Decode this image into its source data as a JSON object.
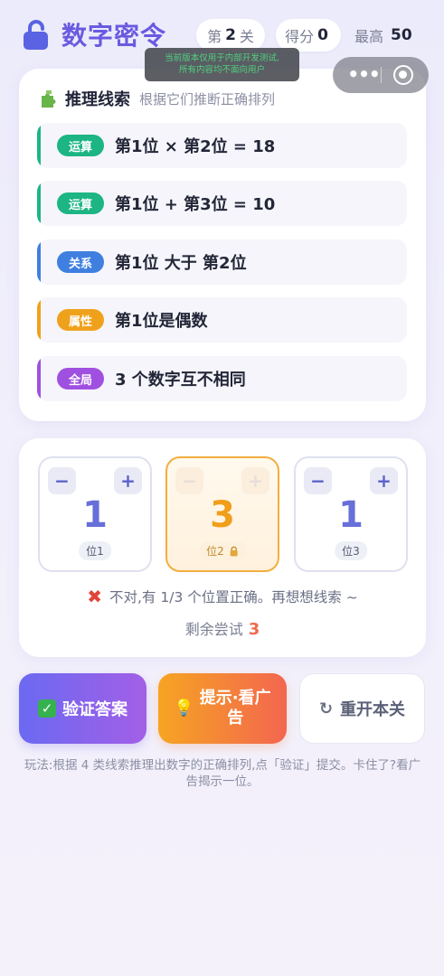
{
  "header": {
    "title": "数字密令",
    "level_prefix": "第",
    "level_value": "2",
    "level_suffix": "关",
    "score_label": "得分",
    "score_value": "0",
    "best_label": "最高",
    "best_value": "50"
  },
  "dev_notice": {
    "line1": "当前版本仅用于内部开发测试,",
    "line2": "所有内容均不面向用户"
  },
  "capsule": {
    "more_glyph": "•••"
  },
  "clues": {
    "title": "推理线索",
    "subtitle": "根据它们推断正确排列",
    "items": [
      {
        "tag": "运算",
        "text": "第1位 × 第2位 = 18",
        "color": "#1cb583"
      },
      {
        "tag": "运算",
        "text": "第1位 + 第3位 = 10",
        "color": "#1cb583"
      },
      {
        "tag": "关系",
        "text": "第1位 大于 第2位",
        "color": "#3f7fe0"
      },
      {
        "tag": "属性",
        "text": "第1位是偶数",
        "color": "#f0a11c"
      },
      {
        "tag": "全局",
        "text": "3 个数字互不相同",
        "color": "#a050e0"
      }
    ]
  },
  "digits": [
    {
      "value": "1",
      "label": "位1",
      "locked": false,
      "minus": "−",
      "plus": "+"
    },
    {
      "value": "3",
      "label": "位2",
      "locked": true,
      "minus": "−",
      "plus": "+"
    },
    {
      "value": "1",
      "label": "位3",
      "locked": false,
      "minus": "−",
      "plus": "+"
    }
  ],
  "feedback": {
    "icon": "✖",
    "text": "不对,有 1/3 个位置正确。再想想线索 ~"
  },
  "attempts": {
    "label": "剩余尝试",
    "value": "3"
  },
  "actions": {
    "verify_label": "验证答案",
    "hint_line1": "提示·看广",
    "hint_line2": "告",
    "reset_label": "重开本关",
    "reset_icon": "↻",
    "check_glyph": "✓",
    "bulb_glyph": "💡"
  },
  "howto": "玩法:根据 4 类线索推理出数字的正确排列,点「验证」提交。卡住了?看广告揭示一位。"
}
